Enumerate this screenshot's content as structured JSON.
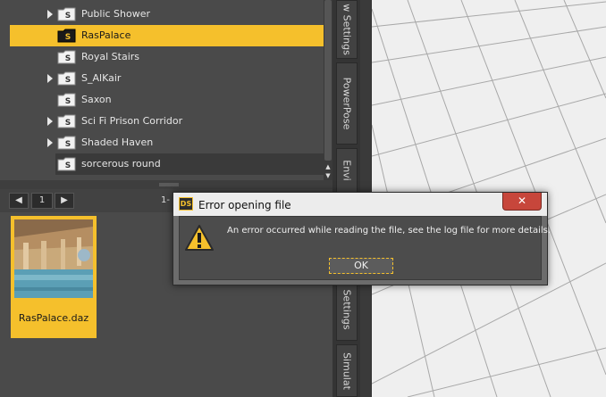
{
  "library": {
    "items": [
      {
        "label": "Public Shower",
        "expandable": true,
        "selected": false
      },
      {
        "label": "RasPalace",
        "expandable": false,
        "selected": true
      },
      {
        "label": "Royal Stairs",
        "expandable": false,
        "selected": false
      },
      {
        "label": "S_AlKair",
        "expandable": true,
        "selected": false
      },
      {
        "label": "Saxon",
        "expandable": false,
        "selected": false
      },
      {
        "label": "Sci Fi Prison Corridor",
        "expandable": true,
        "selected": false
      },
      {
        "label": "Shaded Haven",
        "expandable": true,
        "selected": false
      },
      {
        "label": "sorcerous round",
        "expandable": false,
        "selected": false
      }
    ],
    "folder_icon_letter": "S"
  },
  "pager": {
    "prev_icon": "arrow-left-icon",
    "next_icon": "arrow-right-icon",
    "page": "1",
    "range_text": "1-"
  },
  "assets": {
    "tiles": [
      {
        "label": "RasPalace.daz"
      }
    ]
  },
  "side_tabs": [
    {
      "label": "w Settings"
    },
    {
      "label": "PowerPose"
    },
    {
      "label": "Envi"
    },
    {
      "label": "Settings"
    },
    {
      "label": "Simulat"
    }
  ],
  "dialog": {
    "app_icon_text": "DS",
    "title": "Error opening file",
    "close_icon": "close-icon",
    "warning_icon": "warning-icon",
    "message": "An error occurred while reading the file, see the log file for more details.",
    "ok_label": "OK"
  },
  "colors": {
    "accent": "#f5c02c",
    "panel": "#4a4a4a",
    "close_red": "#c7463b"
  }
}
